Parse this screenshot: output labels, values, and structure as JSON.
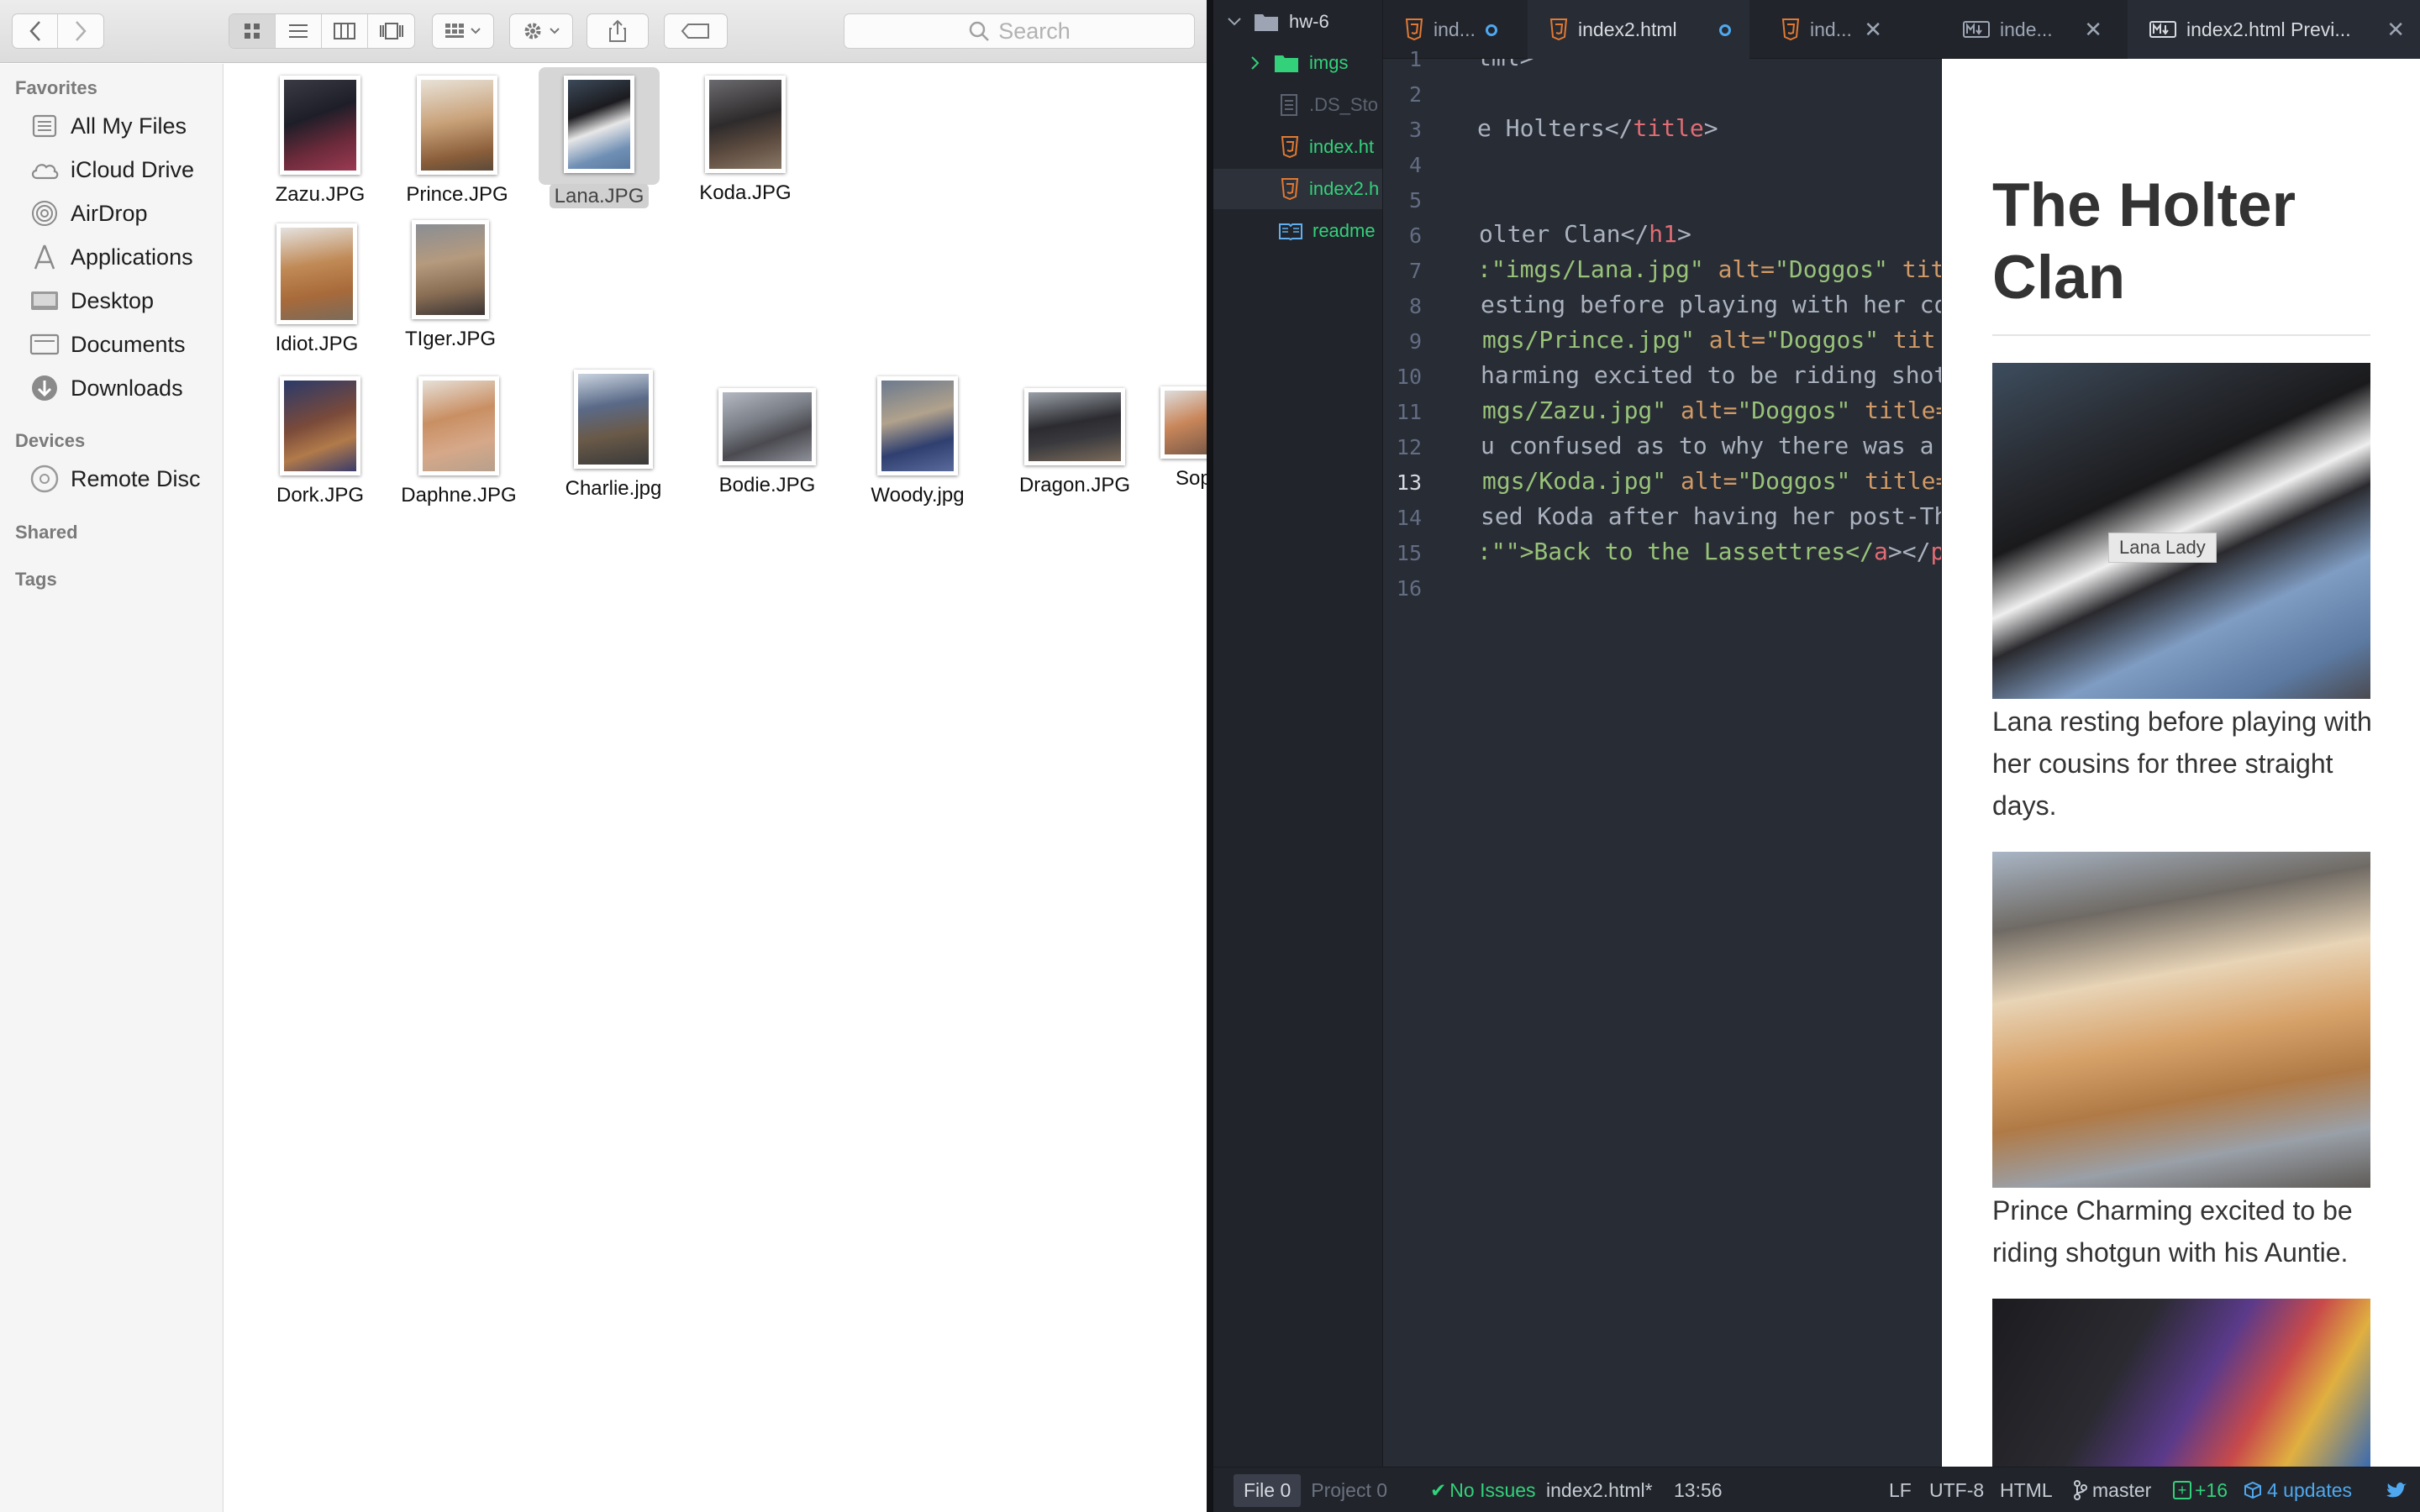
{
  "finder": {
    "search_placeholder": "Search",
    "sidebar": {
      "favorites_label": "Favorites",
      "favorites": [
        "All My Files",
        "iCloud Drive",
        "AirDrop",
        "Applications",
        "Desktop",
        "Documents",
        "Downloads"
      ],
      "devices_label": "Devices",
      "devices": [
        "Remote Disc"
      ],
      "shared_label": "Shared",
      "tags_label": "Tags"
    },
    "files": [
      "Zazu.JPG",
      "Prince.JPG",
      "Lana.JPG",
      "Koda.JPG",
      "Idiot.JPG",
      "TIger.JPG",
      "Dork.JPG",
      "Daphne.JPG",
      "Charlie.jpg",
      "Bodie.JPG",
      "Woody.jpg",
      "Dragon.JPG",
      "Sop"
    ],
    "selected_file": "Lana.JPG"
  },
  "editor": {
    "tree": {
      "root": "hw-6",
      "items": [
        "imgs",
        ".DS_Sto",
        "index.ht",
        "index2.h",
        "readme"
      ]
    },
    "tabs_left": [
      "ind...",
      "index2.html",
      "ind..."
    ],
    "tabs_right": [
      "inde...",
      "index2.html Previ..."
    ],
    "line_numbers": [
      "1",
      "2",
      "3",
      "4",
      "5",
      "6",
      "7",
      "8",
      "9",
      "10",
      "11",
      "12",
      "13",
      "14",
      "15",
      "16"
    ],
    "code": {
      "l1": "tml>",
      "l3a": "e Holters</",
      "l3b": "title",
      "l3c": ">",
      "l6a": "olter Clan</",
      "l6b": "h1",
      "l6c": ">",
      "l7a": ":\"imgs/Lana.jpg\"",
      "l7b": " alt=",
      "l7c": "\"Doggos\"",
      "l7d": " tit",
      "l8": "esting before playing with her co",
      "l9a": "mgs/Prince.jpg\"",
      "l9b": " alt=",
      "l9c": "\"Doggos\"",
      "l9d": " tit",
      "l10": "harming excited to be riding shot",
      "l11a": "mgs/Zazu.jpg\"",
      "l11b": " alt=",
      "l11c": "\"Doggos\"",
      "l11d": " title=",
      "l12": "u confused as to why there was a",
      "l13a": "mgs/Koda.jpg\"",
      "l13b": " alt=",
      "l13c": "\"Doggos\"",
      "l13d": " title=",
      "l14": "sed Koda after having her post-Th",
      "l15a": ":\"\">Back to the Lassettres</",
      "l15b": "a",
      "l15c": "></",
      "l15d": "p"
    },
    "preview": {
      "title": "The Holter Clan",
      "tooltip": "Lana Lady",
      "caption1": "Lana resting before playing with her cousins for three straight days.",
      "caption2": "Prince Charming excited to be riding shotgun with his Auntie."
    },
    "status": {
      "file_label": "File",
      "file_count": "0",
      "project_label": "Project",
      "project_count": "0",
      "issues": "No Issues",
      "filename": "index2.html*",
      "cursor": "13:56",
      "line_ending": "LF",
      "encoding": "UTF-8",
      "grammar": "HTML",
      "branch": "master",
      "diff": "+16",
      "updates": "4 updates"
    }
  }
}
